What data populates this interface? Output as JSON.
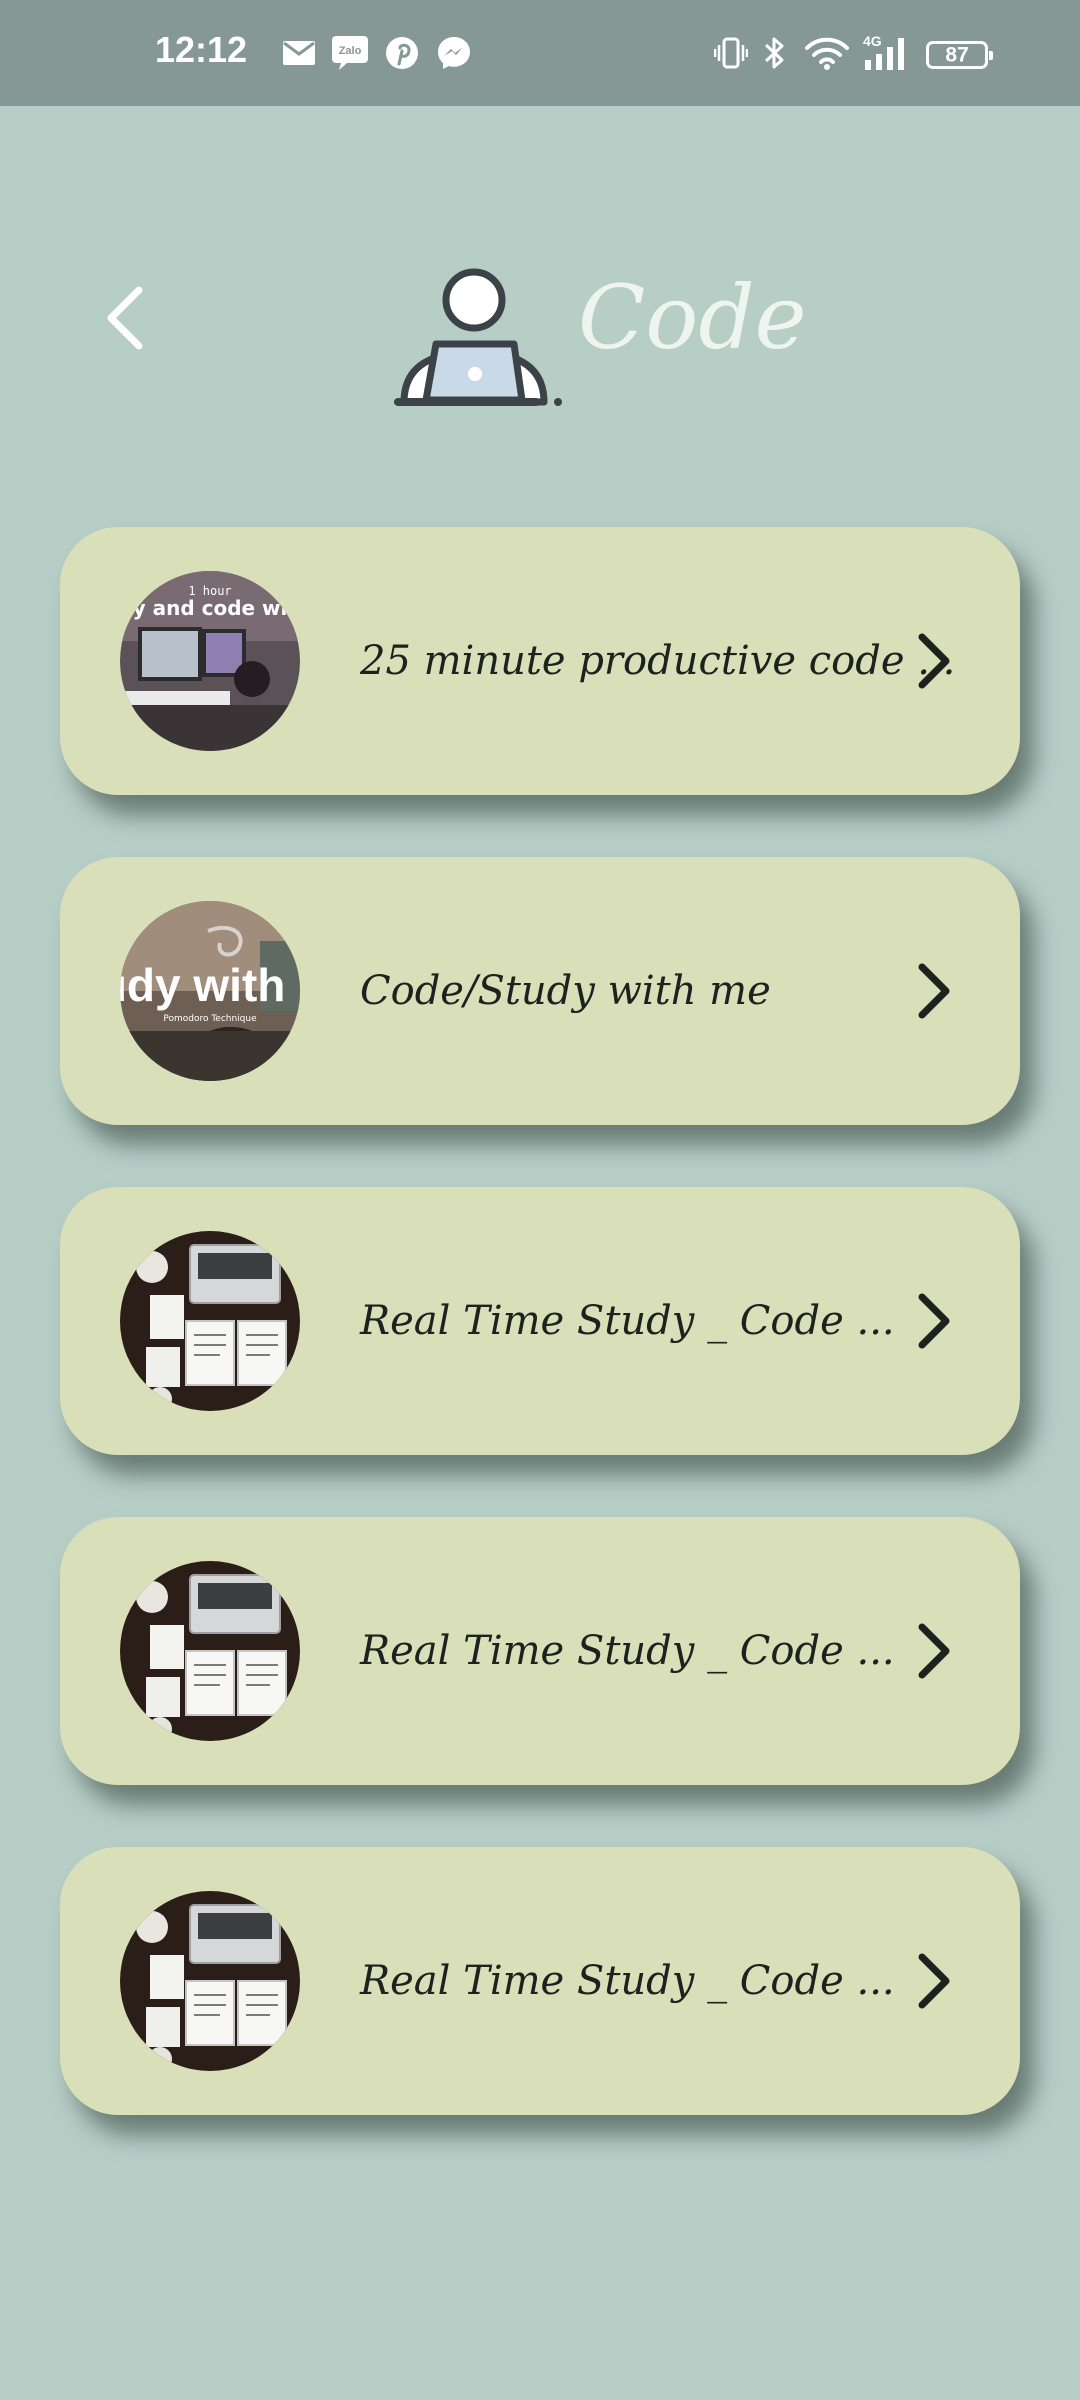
{
  "status_bar": {
    "time": "12:12",
    "left_icons": [
      "gmail-icon",
      "zalo-icon",
      "pinterest-icon",
      "messenger-icon"
    ],
    "zalo_text": "Zalo",
    "network_label": "4G",
    "battery_level": "87",
    "right_icons": [
      "vibrate-icon",
      "bluetooth-icon",
      "wifi-icon",
      "signal-icon",
      "battery-icon"
    ]
  },
  "header": {
    "back_icon": "back-chevron-icon",
    "illustration": "person-laptop-icon",
    "title": "Code"
  },
  "playlist": [
    {
      "label": "25 minute productive code ...",
      "thumbnail": "study-code-thumbnail",
      "thumbnail_text": [
        "1 hour",
        "y and code wi"
      ],
      "chevron": "chevron-right-icon"
    },
    {
      "label": "Code/Study with me",
      "thumbnail": "study-with-me-thumbnail",
      "thumbnail_text": [
        "tudy with M",
        "Pomodoro Technique"
      ],
      "chevron": "chevron-right-icon"
    },
    {
      "label": "Real Time Study _ Code ...",
      "thumbnail": "desk-laptop-thumbnail",
      "chevron": "chevron-right-icon"
    },
    {
      "label": "Real Time Study _ Code ...",
      "thumbnail": "desk-laptop-thumbnail",
      "chevron": "chevron-right-icon"
    },
    {
      "label": "Real Time Study _ Code ...",
      "thumbnail": "desk-laptop-thumbnail",
      "chevron": "chevron-right-icon"
    }
  ],
  "colors": {
    "background": "#b7cec7",
    "status_bar": "#869893",
    "card": "#d9dfb9",
    "text": "#1e211d",
    "title": "#eef4ef"
  }
}
